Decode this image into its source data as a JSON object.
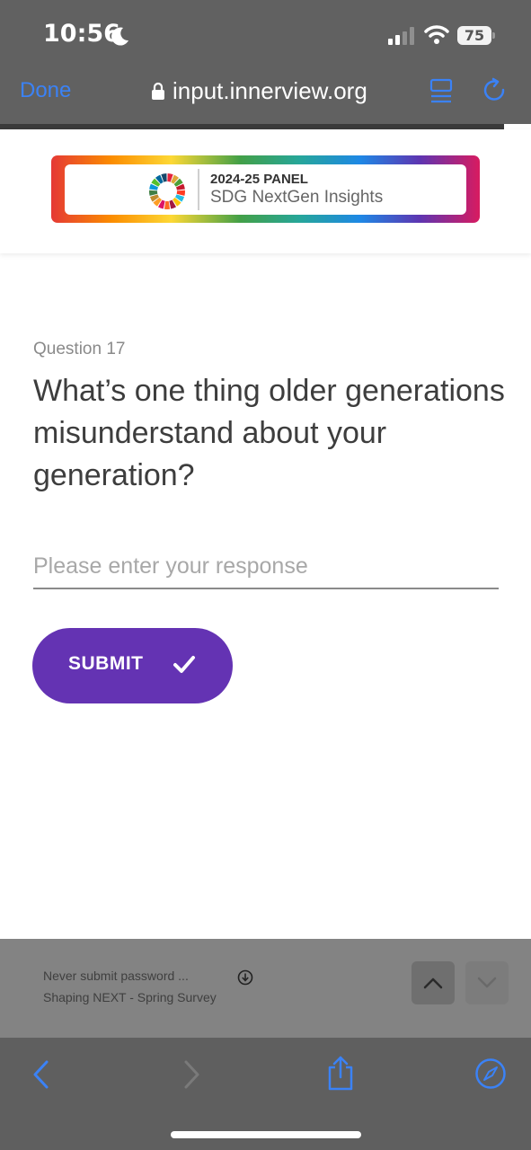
{
  "status_bar": {
    "time": "10:56",
    "battery": "75",
    "icons": [
      "moon-icon",
      "cellular-signal-icon",
      "wifi-icon",
      "battery-icon"
    ]
  },
  "browser": {
    "done_label": "Done",
    "url": "input.innerview.org",
    "icons": [
      "lock-icon",
      "reader-view-icon",
      "reload-icon"
    ],
    "load_progress": 0.95
  },
  "header": {
    "banner_line1": "2024-25 PANEL",
    "banner_line2": "SDG NextGen Insights",
    "logo_icon": "sdg-wheel-icon"
  },
  "question": {
    "number": "Question 17",
    "text": "What’s one thing older generations misunderstand about your generation?",
    "response_placeholder": "Please enter your response",
    "response_value": "",
    "submit_label": "SUBMIT"
  },
  "find_bar": {
    "line1": "Never submit password   ...",
    "line2": "Shaping NEXT - Spring Survey",
    "icons": [
      "download-icon",
      "chevron-up-icon",
      "chevron-down-icon"
    ]
  },
  "toolbar": {
    "icons": [
      "back-arrow-icon",
      "forward-arrow-icon",
      "share-icon",
      "safari-compass-icon"
    ]
  },
  "colors": {
    "accent": "#6433b3",
    "link_blue": "#3b82f6",
    "chrome_gray": "#616161"
  }
}
